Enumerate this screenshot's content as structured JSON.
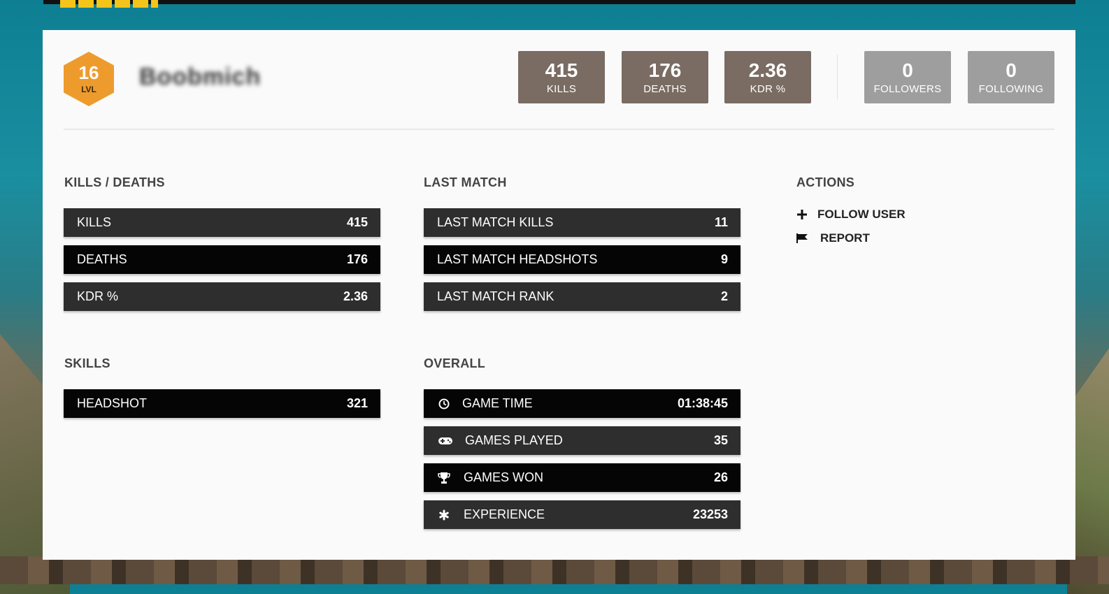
{
  "profile": {
    "level": "16",
    "level_label": "LVL",
    "username": "Boobmich"
  },
  "header_stats": [
    {
      "value": "415",
      "label": "KILLS"
    },
    {
      "value": "176",
      "label": "DEATHS"
    },
    {
      "value": "2.36",
      "label": "KDR %"
    },
    {
      "value": "0",
      "label": "FOLLOWERS"
    },
    {
      "value": "0",
      "label": "FOLLOWING"
    }
  ],
  "kills_deaths": {
    "title": "KILLS / DEATHS",
    "rows": [
      {
        "label": "KILLS",
        "value": "415"
      },
      {
        "label": "DEATHS",
        "value": "176"
      },
      {
        "label": "KDR %",
        "value": "2.36"
      }
    ]
  },
  "last_match": {
    "title": "LAST MATCH",
    "rows": [
      {
        "label": "LAST MATCH KILLS",
        "value": "11"
      },
      {
        "label": "LAST MATCH HEADSHOTS",
        "value": "9"
      },
      {
        "label": "LAST MATCH RANK",
        "value": "2"
      }
    ]
  },
  "actions": {
    "title": "ACTIONS",
    "items": [
      {
        "label": "FOLLOW USER",
        "icon": "plus-icon"
      },
      {
        "label": "REPORT",
        "icon": "flag-icon"
      }
    ]
  },
  "skills": {
    "title": "SKILLS",
    "rows": [
      {
        "label": "HEADSHOT",
        "value": "321"
      }
    ]
  },
  "overall": {
    "title": "OVERALL",
    "rows": [
      {
        "label": "GAME TIME",
        "value": "01:38:45",
        "icon": "clock-icon"
      },
      {
        "label": "GAMES PLAYED",
        "value": "35",
        "icon": "gamepad-icon"
      },
      {
        "label": "GAMES WON",
        "value": "26",
        "icon": "trophy-icon"
      },
      {
        "label": "EXPERIENCE",
        "value": "23253",
        "icon": "asterisk-icon"
      }
    ]
  },
  "colors": {
    "badge": "#ee9b2e",
    "stat_dark": "#7a6c62",
    "stat_grey": "#9e9e9e",
    "row_dark": "#2e2e2e",
    "row_black": "#050505"
  }
}
